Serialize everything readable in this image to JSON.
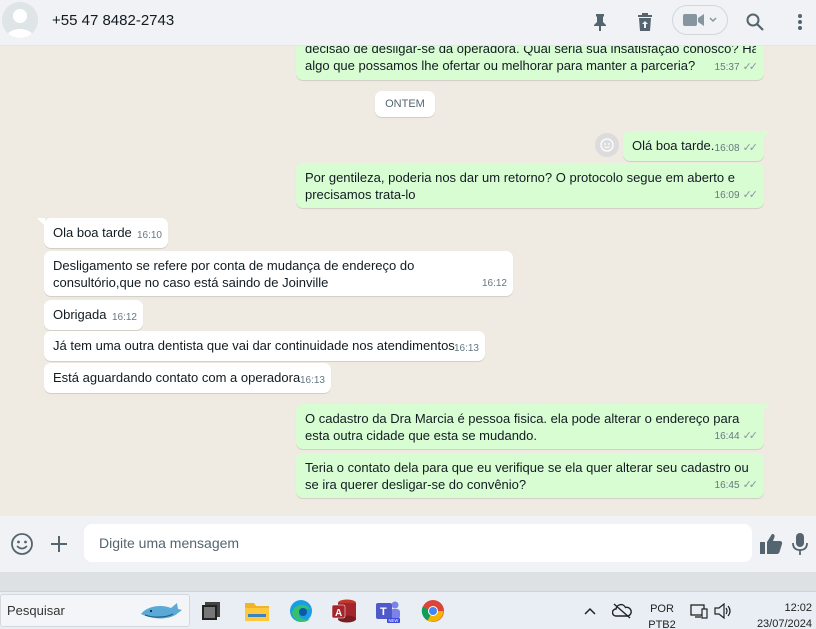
{
  "header": {
    "contact": "+55 47 8482-2743",
    "icons": [
      "pin-icon",
      "trash-icon",
      "video-call-icon",
      "search-icon",
      "menu-icon"
    ]
  },
  "chat": {
    "top_partial": {
      "line1": "decisão de desligar-se da operadora. Qual seria sua insatisfação conosco? Há",
      "line2": "algo que possamos lhe ofertar ou melhorar para manter a parceria?",
      "time": "15:37"
    },
    "date_label": "ONTEM",
    "messages": [
      {
        "dir": "out",
        "text": "Olá boa tarde.",
        "time": "16:08"
      },
      {
        "dir": "out",
        "text": "Por gentileza, poderia nos dar um retorno? O protocolo segue em aberto e precisamos trata-lo",
        "time": "16:09"
      },
      {
        "dir": "in",
        "text": "Ola boa tarde",
        "time": "16:10"
      },
      {
        "dir": "in",
        "text": "Desligamento se refere por conta de mudança de endereço do consultório,que no caso está saindo de Joinville",
        "time": "16:12"
      },
      {
        "dir": "in",
        "text": "Obrigada",
        "time": "16:12"
      },
      {
        "dir": "in",
        "text": "Já tem uma outra dentista que vai dar continuidade nos atendimentos",
        "time": "16:13"
      },
      {
        "dir": "in",
        "text": "Está aguardando contato com a operadora",
        "time": "16:13"
      },
      {
        "dir": "out",
        "text": "O cadastro da Dra Marcia é pessoa fisica. ela pode alterar o endereço para esta outra cidade que esta se mudando.",
        "time": "16:44"
      },
      {
        "dir": "out",
        "text": "Teria o contato dela para que eu verifique se ela quer alterar seu cadastro ou se ira querer desligar-se do convênio?",
        "time": "16:45"
      }
    ]
  },
  "composer": {
    "placeholder": "Digite uma mensagem"
  },
  "taskbar": {
    "search_label": "Pesquisar",
    "language_line1": "POR",
    "language_line2": "PTB2",
    "time": "12:02",
    "date": "23/07/2024"
  },
  "colors": {
    "outgoing_bubble": "#d9fdd3",
    "incoming_bubble": "#ffffff",
    "chat_bg": "#efeae2",
    "header_bg": "#f0f2f5"
  }
}
